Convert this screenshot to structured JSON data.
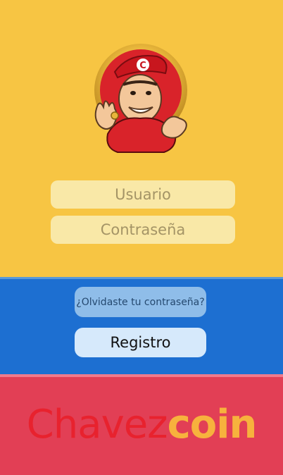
{
  "login": {
    "username_placeholder": "Usuario",
    "password_placeholder": "Contraseña",
    "forgot_label": "¿Olvidaste tu contraseña?",
    "register_label": "Registro"
  },
  "brand": {
    "part1": "Chavez",
    "part2": "coin"
  },
  "logo": {
    "cap_letter": "C"
  },
  "colors": {
    "yellow": "#f7c543",
    "blue": "#1d6fd1",
    "red": "#e23f55",
    "brand_red": "#e8222e",
    "brand_gold": "#f7b23d"
  }
}
